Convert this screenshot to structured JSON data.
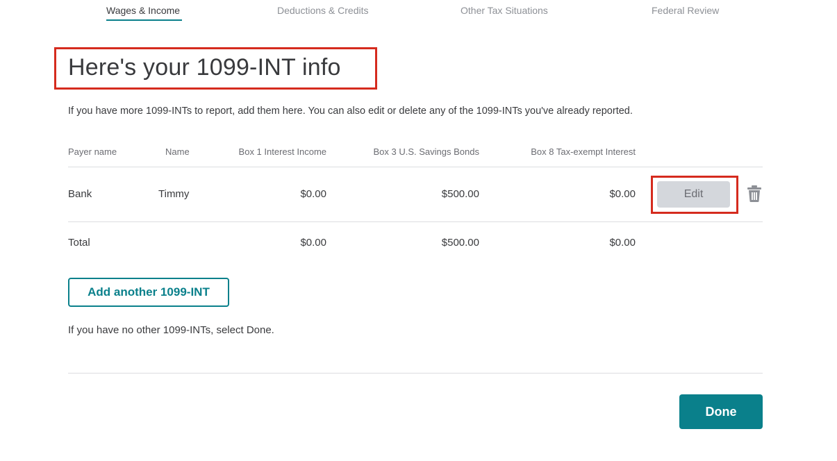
{
  "nav": {
    "tabs": [
      {
        "label": "Wages & Income",
        "active": true
      },
      {
        "label": "Deductions & Credits",
        "active": false
      },
      {
        "label": "Other Tax Situations",
        "active": false
      },
      {
        "label": "Federal Review",
        "active": false
      }
    ]
  },
  "page": {
    "title": "Here's your 1099-INT info",
    "intro": {
      "part1": "If you have more 1099-INTs to report, ",
      "add": "add",
      "part2": " them here. You can also ",
      "edit": "edit",
      "part3": " or ",
      "delete": "delete",
      "part4": " any of the 1099-INTs you've already reported."
    }
  },
  "table": {
    "headers": [
      "Payer name",
      "Name",
      "Box 1 Interest Income",
      "Box 3 U.S. Savings Bonds",
      "Box 8 Tax-exempt Interest"
    ],
    "rows": [
      {
        "payer": "Bank",
        "name": "Timmy",
        "box1": "$0.00",
        "box3": "$500.00",
        "box8": "$0.00"
      }
    ],
    "total": {
      "label": "Total",
      "box1": "$0.00",
      "box3": "$500.00",
      "box8": "$0.00"
    },
    "edit_label": "Edit",
    "delete_icon": "trash-icon"
  },
  "actions": {
    "add_another": "Add another 1099-INT",
    "note_prefix": "If you have no other 1099-INTs, select ",
    "note_done": "Done",
    "note_suffix": ".",
    "done": "Done"
  },
  "colors": {
    "accent": "#0a808b",
    "highlight": "#d52b1e"
  }
}
